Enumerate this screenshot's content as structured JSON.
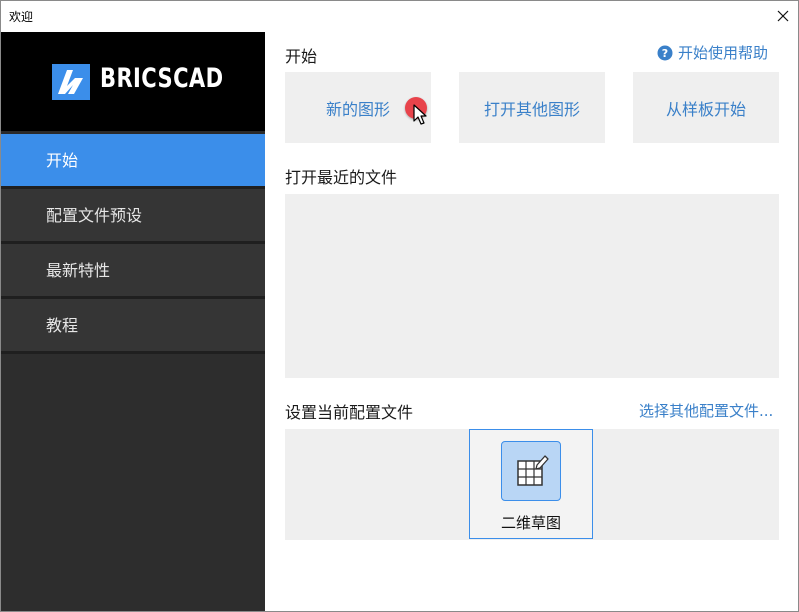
{
  "window": {
    "title": "欢迎"
  },
  "logo": {
    "text": "BRICSCAD"
  },
  "sidebar": {
    "items": [
      {
        "label": "开始",
        "active": true
      },
      {
        "label": "配置文件预设",
        "active": false
      },
      {
        "label": "最新特性",
        "active": false
      },
      {
        "label": "教程",
        "active": false
      }
    ]
  },
  "main": {
    "start_title": "开始",
    "help_link": "开始使用帮助",
    "tiles": [
      {
        "label": "新的图形"
      },
      {
        "label": "打开其他图形"
      },
      {
        "label": "从样板开始"
      }
    ],
    "recent_title": "打开最近的文件",
    "profile_title": "设置当前配置文件",
    "profile_link": "选择其他配置文件...",
    "profile_card_label": "二维草图"
  },
  "colors": {
    "accent": "#3b8eea",
    "link": "#3a80c9",
    "sidebar_bg": "#2d2d2d",
    "logo_bg": "#000000",
    "panel_bg": "#efefef"
  },
  "icons": {
    "close": "close-icon",
    "help": "help-icon",
    "logo": "bricscad-logo-icon",
    "profile": "grid-pencil-icon"
  }
}
